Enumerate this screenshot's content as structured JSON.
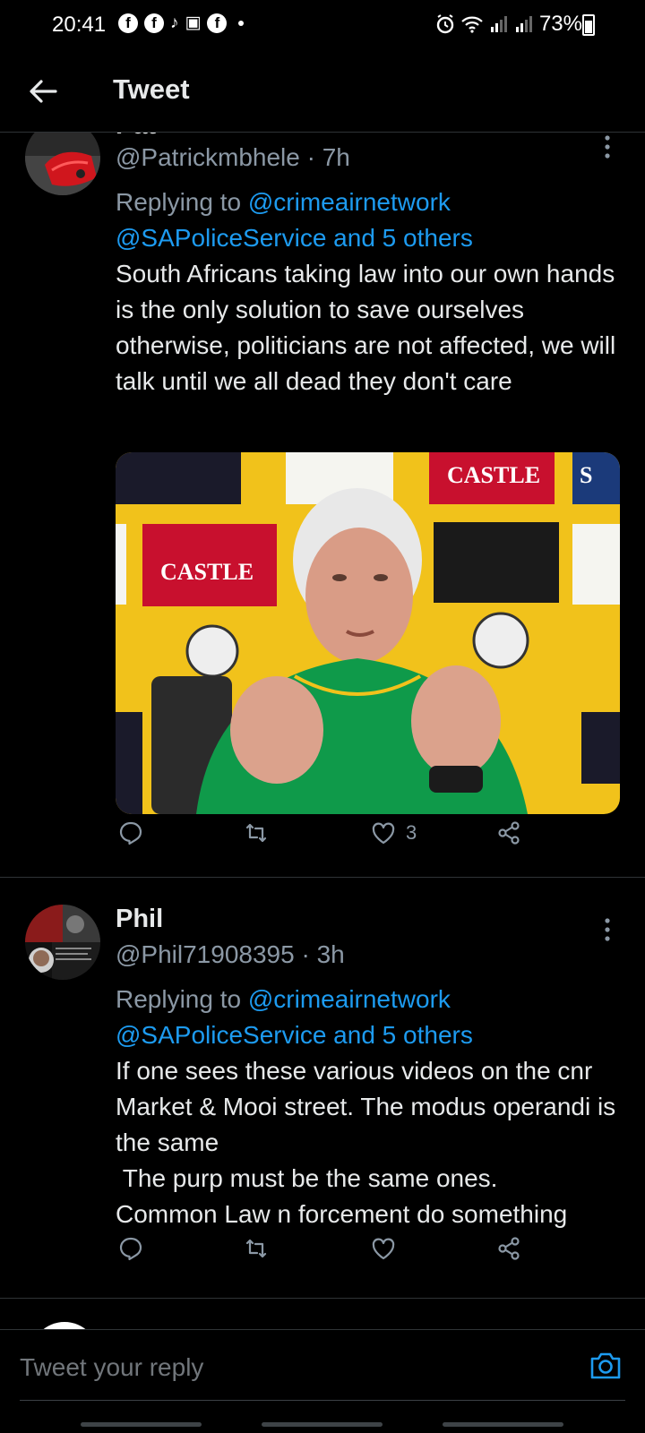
{
  "status_bar": {
    "time": "20:41",
    "battery": "73%"
  },
  "header": {
    "title": "Tweet"
  },
  "tweets": [
    {
      "display_name": "Pat",
      "handle": "@Patrickmbhele",
      "time": "7h",
      "replying_prefix": "Replying to ",
      "mention_1": "@crimeairnetwork",
      "mention_2": "@SAPoliceService and 5 others",
      "text": "South Africans taking law into our own hands is the only solution to save ourselves otherwise, politicians are not affected, we will talk until we all dead they don't care",
      "has_photo": true,
      "like_count": "3"
    },
    {
      "display_name": "Phil",
      "handle": "@Phil71908395",
      "time": "3h",
      "replying_prefix": "Replying to ",
      "mention_1": "@crimeairnetwork",
      "mention_2": "@SAPoliceService and 5 others",
      "text": "If one sees these various videos on the cnr Market & Mooi street. The modus operandi is the same\n The purp must be the same ones.\nCommon Law n forcement do something",
      "has_photo": false,
      "like_count": ""
    }
  ],
  "photo": {
    "sponsor_boards": [
      "CASTLE",
      "CASTLE",
      "S"
    ]
  },
  "reply_bar": {
    "placeholder": "Tweet your reply"
  },
  "colors": {
    "background": "#000000",
    "accent": "#1d9bf0",
    "text_primary": "#e7e9ea",
    "text_secondary": "#8b98a5"
  }
}
